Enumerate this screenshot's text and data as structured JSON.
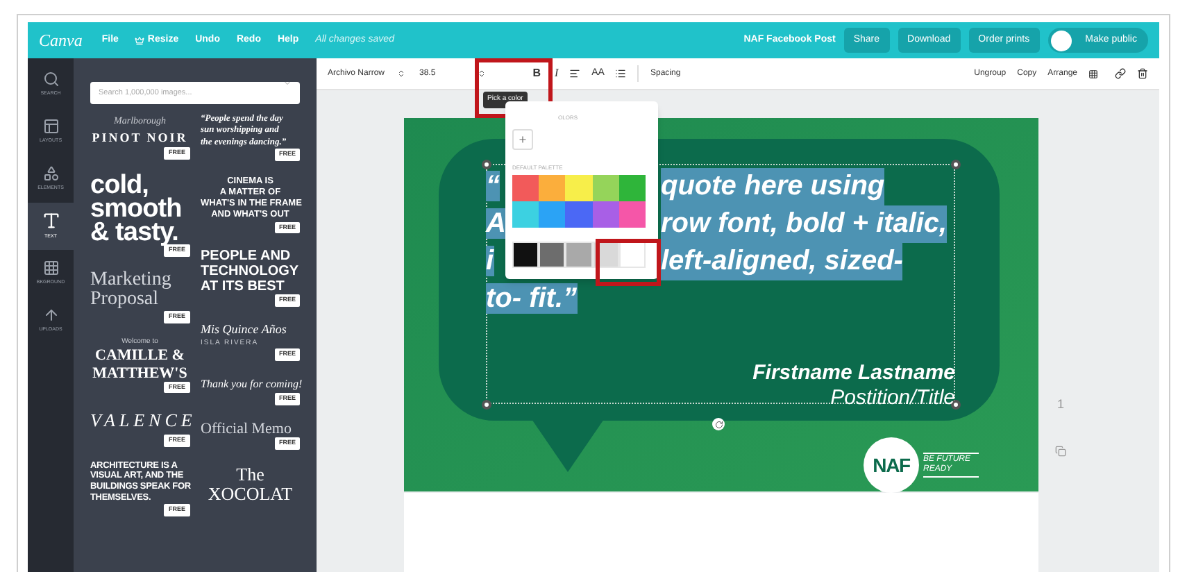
{
  "top_bar": {
    "logo": "Canva",
    "menu": [
      {
        "label": "File",
        "kind": "plain"
      },
      {
        "label": "Resize",
        "kind": "crown"
      },
      {
        "label": "Undo",
        "kind": "plain"
      },
      {
        "label": "Redo",
        "kind": "plain"
      },
      {
        "label": "Help",
        "kind": "plain"
      }
    ],
    "status": "All changes saved",
    "document_title": "NAF Facebook Post",
    "buttons": [
      "Share",
      "Download",
      "Order prints"
    ],
    "make_public": {
      "label": "Make public",
      "on": false
    }
  },
  "nav": [
    {
      "label": "SEARCH",
      "kind": "search",
      "selected": false
    },
    {
      "label": "LAYOUTS",
      "kind": "layouts",
      "selected": false
    },
    {
      "label": "ELEMENTS",
      "kind": "elements",
      "selected": false
    },
    {
      "label": "TEXT",
      "kind": "text",
      "selected": true
    },
    {
      "label": "BKGROUND",
      "kind": "background",
      "selected": false
    },
    {
      "label": "UPLOADS",
      "kind": "uploads",
      "selected": false
    }
  ],
  "search": {
    "placeholder": "Search 1,000,000 images..."
  },
  "templates": {
    "column_1": [
      {
        "kind": "pinot",
        "lines": [
          "Marlborough",
          "PINOT NOIR"
        ],
        "badge": "FREE"
      },
      {
        "kind": "chunky",
        "lines": [
          "cold,",
          "smooth",
          "& tasty."
        ],
        "badge": "FREE"
      },
      {
        "kind": "light",
        "lines": [
          "Marketing",
          "Proposal"
        ],
        "badge": "FREE"
      },
      {
        "kind": "wedding",
        "lines": [
          "Welcome to",
          "CAMILLE &",
          "MATTHEW'S"
        ],
        "badge": "FREE"
      },
      {
        "kind": "spaced",
        "lines": [
          "VALENCE"
        ],
        "badge": "FREE"
      },
      {
        "kind": "condensed",
        "lines": [
          "ARCHITECTURE IS A",
          "VISUAL ART, AND THE",
          "BUILDINGS SPEAK FOR",
          "THEMSELVES."
        ],
        "badge": "FREE"
      }
    ],
    "column_2": [
      {
        "kind": "quote",
        "lines": [
          "“People spend the day",
          "sun worshipping and",
          "the evenings dancing.”"
        ],
        "badge": "FREE"
      },
      {
        "kind": "caps",
        "lines": [
          "CINEMA IS",
          "A MATTER OF",
          "WHAT'S IN THE FRAME",
          "AND WHAT'S OUT"
        ],
        "badge": "FREE"
      },
      {
        "kind": "bold",
        "lines": [
          "PEOPLE AND",
          "TECHNOLOGY",
          "AT ITS BEST"
        ],
        "badge": "FREE"
      },
      {
        "kind": "fancy",
        "lines": [
          "Mis Quince Años",
          "ISLA RIVERA"
        ],
        "badge": "FREE"
      },
      {
        "kind": "script",
        "lines": [
          "Thank you for coming!"
        ],
        "badge": "FREE"
      },
      {
        "kind": "memo",
        "lines": [
          "Official Memo"
        ],
        "badge": "FREE"
      },
      {
        "kind": "serif",
        "lines": [
          "The",
          "XOCOLAT"
        ]
      }
    ]
  },
  "toolbar": {
    "font": "Archivo Narrow",
    "size": "38.5",
    "bold": "B",
    "italic": "I",
    "case": "AA",
    "spacing": "Spacing",
    "actions": [
      "Ungroup",
      "Copy",
      "Arrange"
    ]
  },
  "tooltip": "Pick a color",
  "color_popover": {
    "document_colors_label": "OLORS",
    "default_palette_label": "DEFAULT PALETTE",
    "swatches": [
      {
        "color": "#f25a5a"
      },
      {
        "color": "#fbae3c"
      },
      {
        "color": "#f7ee4a"
      },
      {
        "color": "#95d45a"
      },
      {
        "color": "#2fb53a"
      },
      {
        "color": "#3cd1e1"
      },
      {
        "color": "#2ba3f5"
      },
      {
        "color": "#4b68f5"
      },
      {
        "color": "#a85fe6"
      },
      {
        "color": "#f556a8"
      },
      {
        "color": "#111111"
      },
      {
        "color": "#6d6d6d"
      },
      {
        "color": "#a9a9a9"
      },
      {
        "color": "#d9d9d9"
      },
      {
        "color": "#ffffff"
      }
    ]
  },
  "design": {
    "quote_lines": [
      {
        "left": "“",
        "right": "quote here using"
      },
      {
        "left": "A",
        "right": "row font, bold + italic,"
      },
      {
        "left": "i",
        "right": "left-aligned, sized-"
      },
      {
        "left": "to- fit.”"
      }
    ],
    "name": "Firstname Lastname",
    "title": "Postition/Title",
    "logo": {
      "mark": "NAF",
      "tagline": [
        "BE FUTURE",
        "READY"
      ]
    }
  },
  "page_number": "1"
}
